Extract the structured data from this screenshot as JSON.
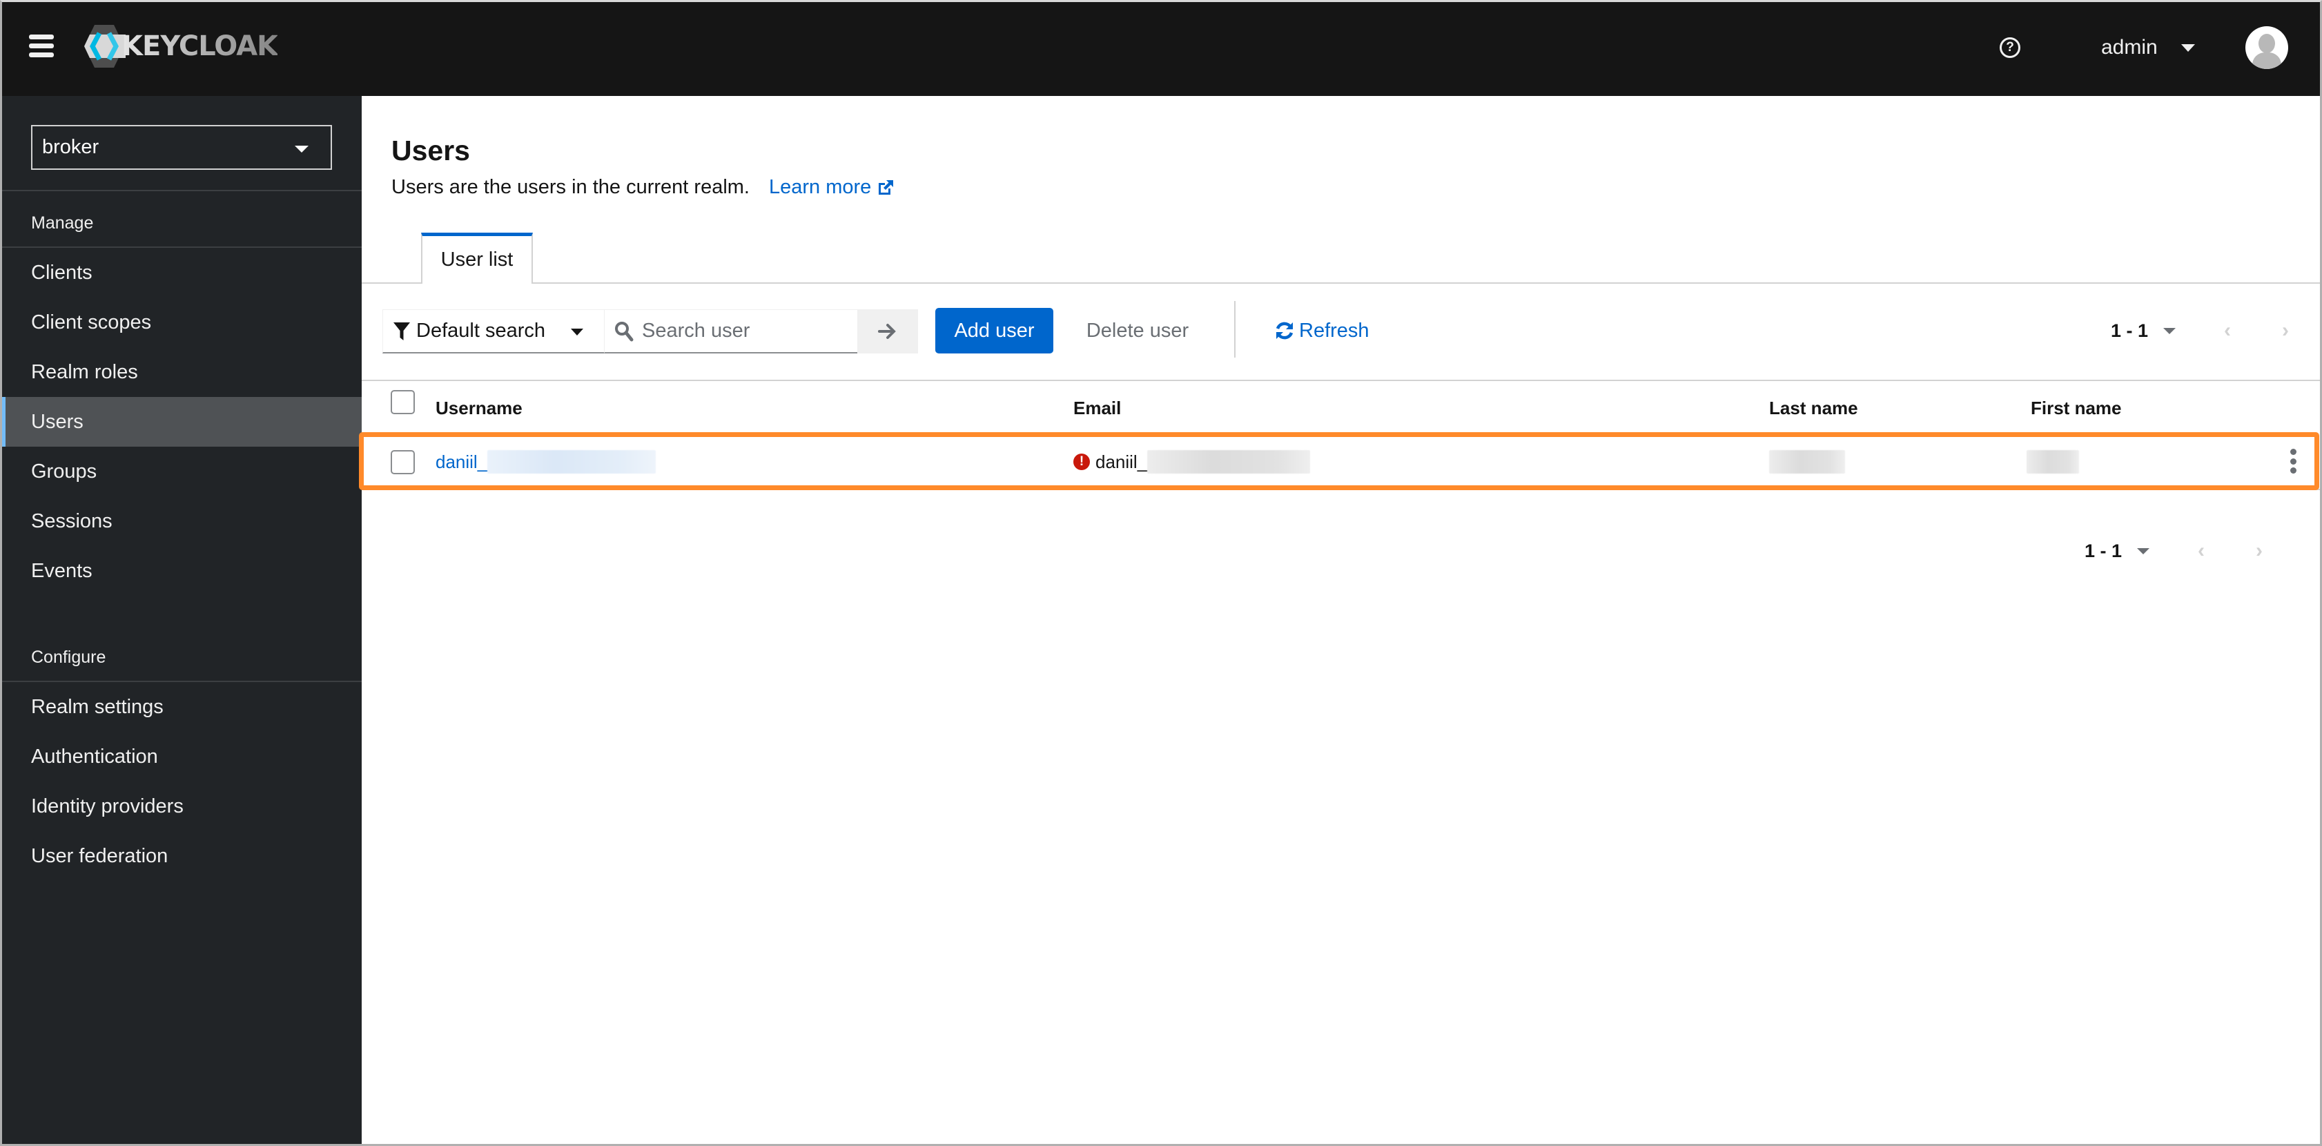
{
  "header": {
    "brand": "KEYCLOAK",
    "user_name": "admin",
    "icons": {
      "menu": "hamburger-icon",
      "help": "help-icon",
      "avatar": "avatar-icon"
    }
  },
  "sidebar": {
    "realm": "broker",
    "sections": [
      {
        "label": "Manage",
        "items": [
          {
            "label": "Clients",
            "active": false
          },
          {
            "label": "Client scopes",
            "active": false
          },
          {
            "label": "Realm roles",
            "active": false
          },
          {
            "label": "Users",
            "active": true
          },
          {
            "label": "Groups",
            "active": false
          },
          {
            "label": "Sessions",
            "active": false
          },
          {
            "label": "Events",
            "active": false
          }
        ]
      },
      {
        "label": "Configure",
        "items": [
          {
            "label": "Realm settings",
            "active": false
          },
          {
            "label": "Authentication",
            "active": false
          },
          {
            "label": "Identity providers",
            "active": false
          },
          {
            "label": "User federation",
            "active": false
          }
        ]
      }
    ]
  },
  "main": {
    "title": "Users",
    "description": "Users are the users in the current realm.",
    "learn_more": "Learn more",
    "tabs": [
      {
        "label": "User list",
        "active": true
      }
    ],
    "toolbar": {
      "filter_label": "Default search",
      "search_placeholder": "Search user",
      "search_value": "",
      "add_user": "Add user",
      "delete_user": "Delete user",
      "refresh": "Refresh",
      "pagination_range": "1 - 1"
    },
    "table": {
      "columns": [
        "Username",
        "Email",
        "Last name",
        "First name"
      ],
      "rows": [
        {
          "username": "daniil_",
          "username_redacted": true,
          "email": "daniil_",
          "email_redacted": true,
          "email_status": "not-verified",
          "last_name_redacted": true,
          "first_name_redacted": true,
          "highlighted": true
        }
      ]
    },
    "bottom_pagination_range": "1 - 1"
  },
  "colors": {
    "masthead": "#151515",
    "sidebar": "#212427",
    "sidebar_active": "#4f5255",
    "active_indicator": "#73bcf7",
    "primary": "#0066cc",
    "danger": "#c9190b",
    "highlight": "#ff8a2a"
  }
}
